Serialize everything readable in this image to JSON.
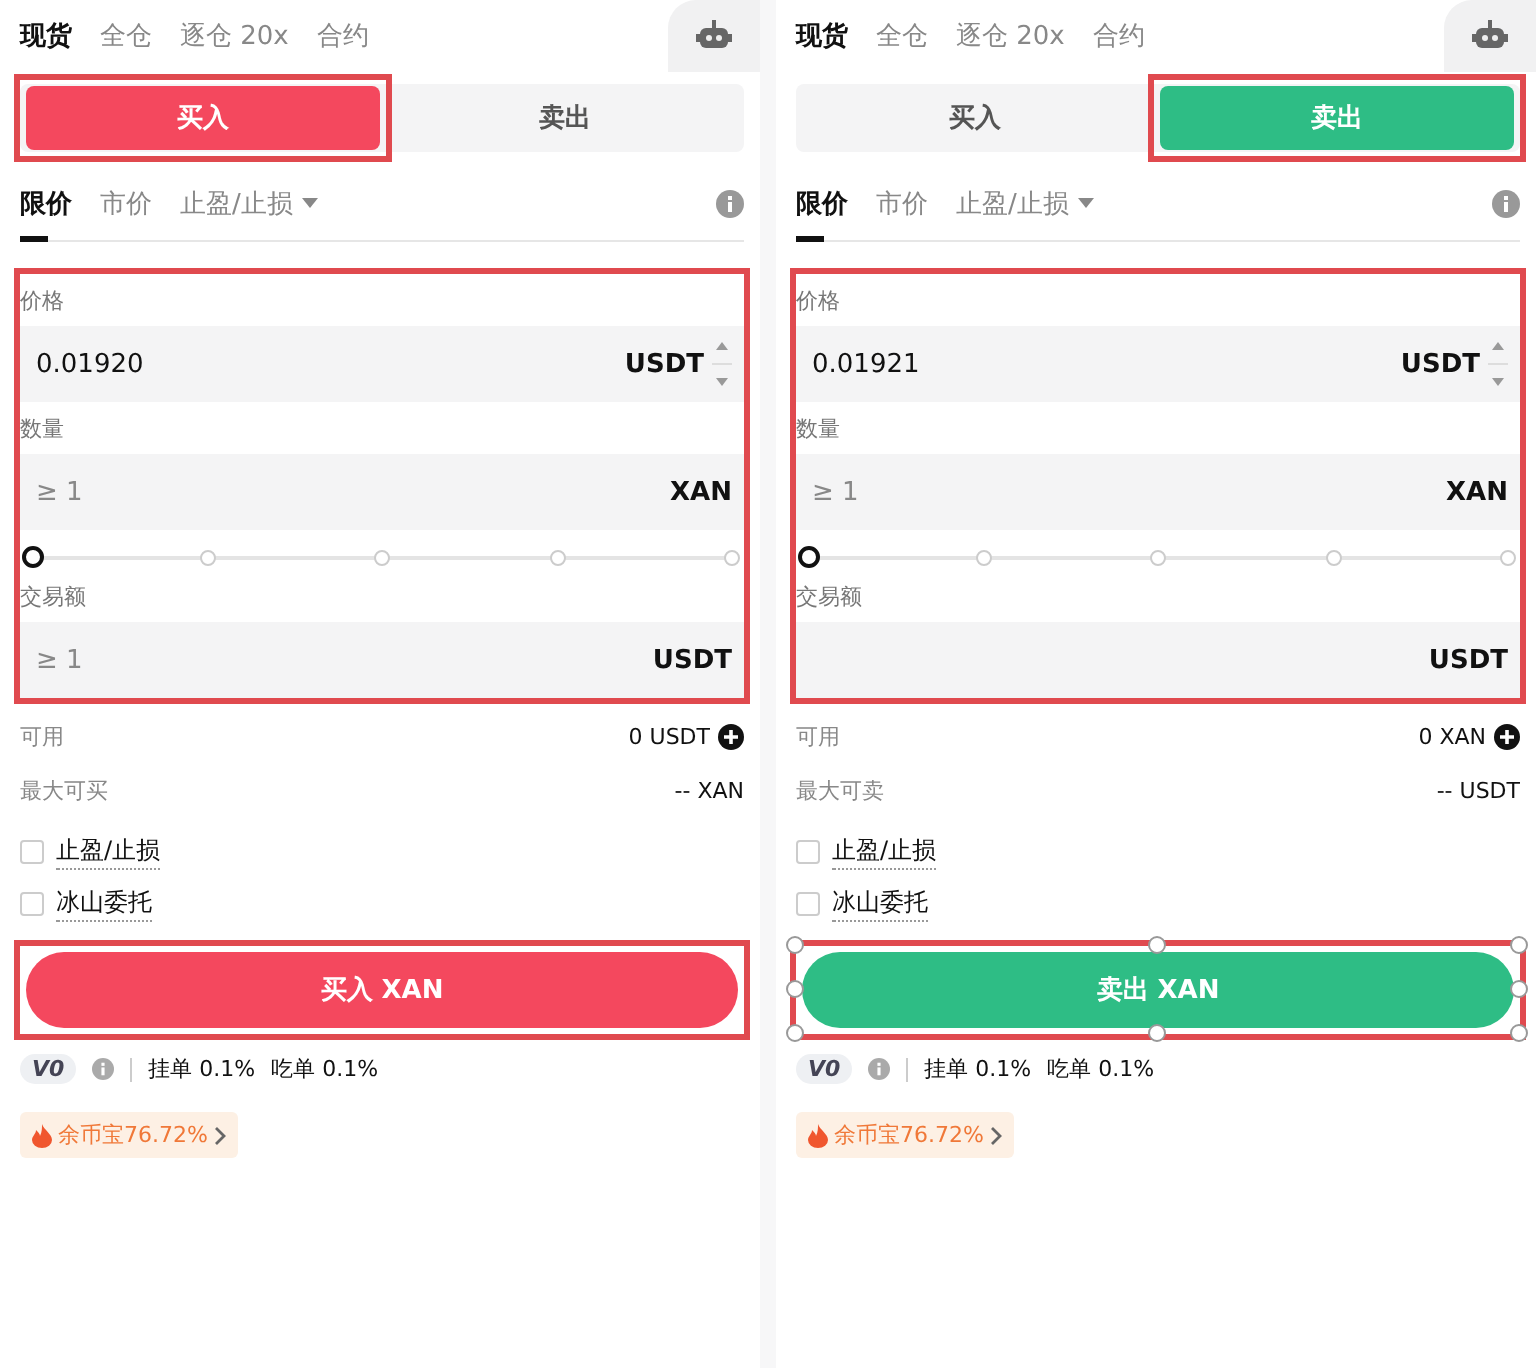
{
  "panels": [
    {
      "market_tabs": [
        {
          "label": "现货",
          "selected": true
        },
        {
          "label": "全仓",
          "selected": false
        },
        {
          "label": "逐仓 20x",
          "selected": false
        },
        {
          "label": "合约",
          "selected": false
        }
      ],
      "side_tabs": [
        {
          "label": "买入",
          "selected": true,
          "highlighted": true
        },
        {
          "label": "卖出",
          "selected": false,
          "highlighted": false
        }
      ],
      "order_tabs": [
        {
          "label": "限价",
          "selected": true,
          "dropdown": false
        },
        {
          "label": "市价",
          "selected": false,
          "dropdown": false
        },
        {
          "label": "止盈/止损",
          "selected": false,
          "dropdown": true
        }
      ],
      "fields_highlighted": true,
      "fields": [
        {
          "label": "价格",
          "value": "0.01920",
          "unit": "USDT",
          "stepper": true
        },
        {
          "label": "数量",
          "placeholder": "≥ 1",
          "unit": "XAN",
          "stepper": false
        }
      ],
      "slider": {
        "level": 0
      },
      "total": {
        "label": "交易额",
        "placeholder": "≥ 1",
        "unit": "USDT"
      },
      "available": {
        "label": "可用",
        "value": "0 USDT"
      },
      "max": {
        "label": "最大可买",
        "value": "-- XAN"
      },
      "options": [
        {
          "label": "止盈/止损",
          "checked": false
        },
        {
          "label": "冰山委托",
          "checked": false
        }
      ],
      "submit": {
        "label": "买入 XAN",
        "kind": "buy",
        "highlighted": true,
        "handles": false
      },
      "vip": "V0",
      "fees": [
        "挂单 0.1%",
        "吃单 0.1%"
      ],
      "promo": "余币宝76.72%"
    },
    {
      "market_tabs": [
        {
          "label": "现货",
          "selected": true
        },
        {
          "label": "全仓",
          "selected": false
        },
        {
          "label": "逐仓 20x",
          "selected": false
        },
        {
          "label": "合约",
          "selected": false
        }
      ],
      "side_tabs": [
        {
          "label": "买入",
          "selected": false,
          "highlighted": false
        },
        {
          "label": "卖出",
          "selected": true,
          "highlighted": true
        }
      ],
      "order_tabs": [
        {
          "label": "限价",
          "selected": true,
          "dropdown": false
        },
        {
          "label": "市价",
          "selected": false,
          "dropdown": false
        },
        {
          "label": "止盈/止损",
          "selected": false,
          "dropdown": true
        }
      ],
      "fields_highlighted": true,
      "fields": [
        {
          "label": "价格",
          "value": "0.01921",
          "unit": "USDT",
          "stepper": true
        },
        {
          "label": "数量",
          "placeholder": "≥ 1",
          "unit": "XAN",
          "stepper": false
        }
      ],
      "slider": {
        "level": 0
      },
      "total": {
        "label": "交易额",
        "unit": "USDT"
      },
      "available": {
        "label": "可用",
        "value": "0 XAN"
      },
      "max": {
        "label": "最大可卖",
        "value": "-- USDT"
      },
      "options": [
        {
          "label": "止盈/止损",
          "checked": false
        },
        {
          "label": "冰山委托",
          "checked": false
        }
      ],
      "submit": {
        "label": "卖出 XAN",
        "kind": "sell",
        "highlighted": true,
        "handles": true
      },
      "vip": "V0",
      "fees": [
        "挂单 0.1%",
        "吃单 0.1%"
      ],
      "promo": "余币宝76.72%"
    }
  ]
}
